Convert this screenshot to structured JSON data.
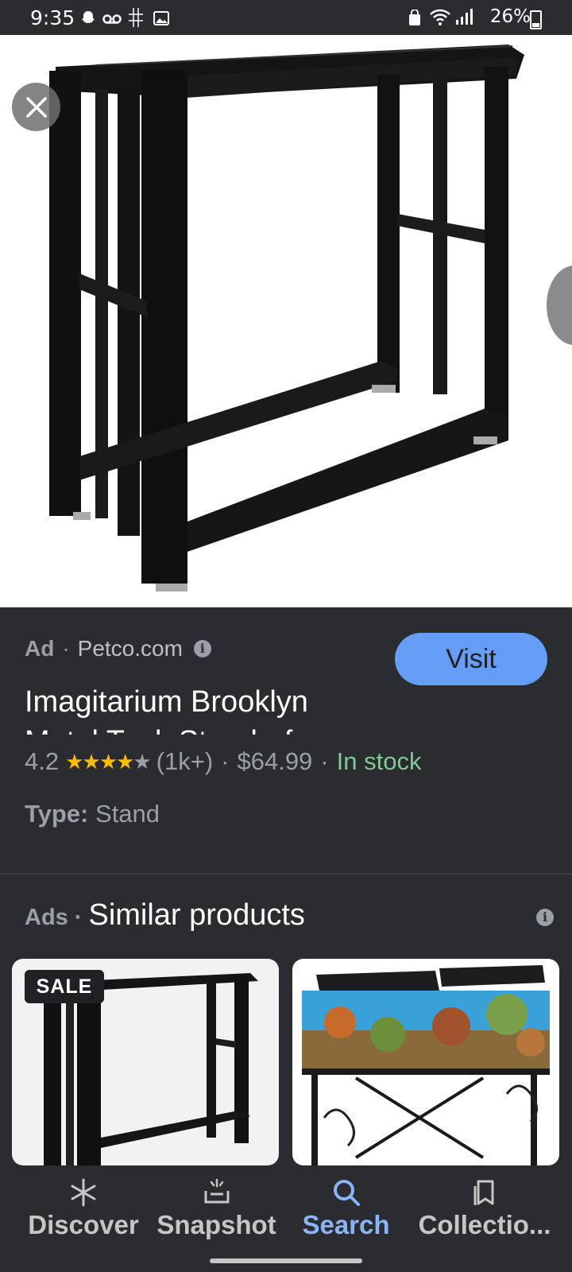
{
  "status_bar": {
    "time": "9:35",
    "battery": "26%"
  },
  "product": {
    "ad_label": "Ad",
    "source": "Petco.com",
    "visit_label": "Visit",
    "title": "Imagitarium Brooklyn Metal Tank Stand - for",
    "rating": "4.2",
    "rating_fraction": 0.84,
    "review_count": "(1k+)",
    "price": "$64.99",
    "availability": "In stock",
    "type_key": "Type:",
    "type_value": "Stand"
  },
  "similar": {
    "ads_label": "Ads",
    "title": "Similar products",
    "cards": [
      {
        "badge": "SALE",
        "image": "black metal tank stand"
      },
      {
        "image": "aquarium on scrollwork stand"
      }
    ]
  },
  "nav": {
    "items": [
      {
        "label": "Discover",
        "icon": "asterisk-icon"
      },
      {
        "label": "Snapshot",
        "icon": "snapshot-icon"
      },
      {
        "label": "Search",
        "icon": "search-icon",
        "active": true
      },
      {
        "label": "Collectio...",
        "icon": "collections-icon"
      }
    ]
  },
  "colors": {
    "background": "#2b2c30",
    "accent": "#8ab4f8",
    "visit_button": "#669df6",
    "in_stock": "#81c995",
    "stars": "#fbbc04"
  }
}
